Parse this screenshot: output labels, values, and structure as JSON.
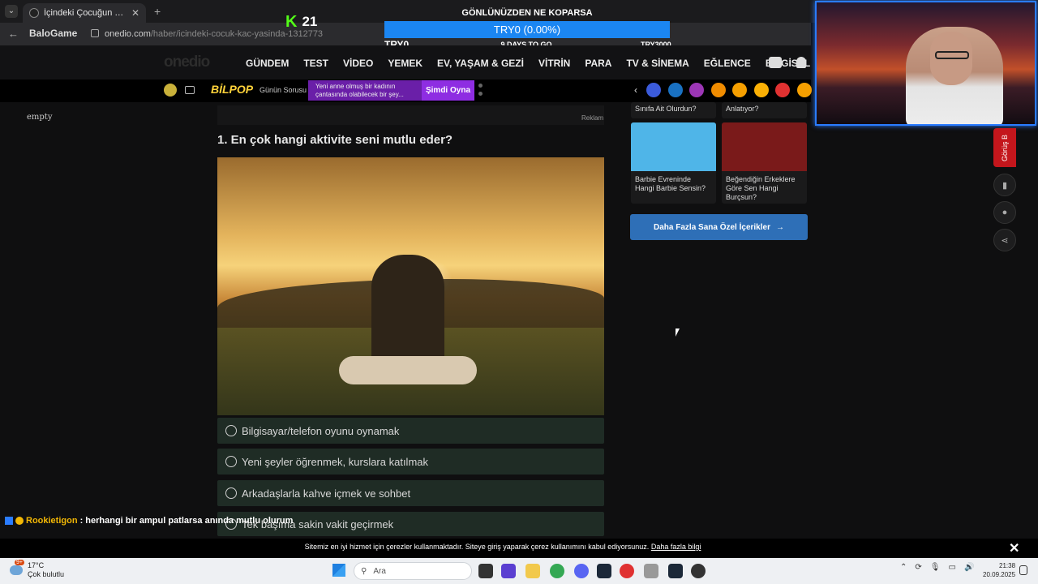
{
  "browser": {
    "tab_title": "İçindeki Çocuğun Yaşı Seni Çok",
    "url_host": "onedio.com",
    "url_path": "/haber/icindeki-cocuk-kac-yasinda-1312773",
    "overlay_stub": "BaloGame"
  },
  "stream": {
    "kick_count": "21",
    "donation_title": "GÖNLÜNÜZDEN NE KOPARSA",
    "donation_progress": "TRY0 (0.00%)",
    "donation_progress_fraction": 0.0,
    "donation_min": "TRY0",
    "donation_days": "9 DAYS TO GO",
    "donation_max": "TRY3000"
  },
  "site": {
    "logo": "onedio",
    "nav": [
      "GÜNDEM",
      "TEST",
      "VİDEO",
      "YEMEK",
      "EV, YAŞAM & GEZİ",
      "VİTRİN",
      "PARA",
      "TV & SİNEMA",
      "EĞLENCE",
      "BİLGİSEL"
    ]
  },
  "subbar": {
    "bilpop": "BİLPOP",
    "daily": "Günün Sorusu",
    "quiz_text": "Yeni anne olmuş bir kadının çantasında olabilecek bir şey...",
    "play": "Şimdi Oyna",
    "story_colors": [
      "#3b5bdb",
      "#1971c2",
      "#9c36b5",
      "#f08c00",
      "#f59f00",
      "#fab005",
      "#e03131",
      "#f59f00"
    ]
  },
  "content": {
    "empty_label": "empty",
    "ad_label": "Reklam",
    "question": "1. En çok hangi aktivite seni mutlu eder?",
    "options": [
      "Bilgisayar/telefon oyunu oynamak",
      "Yeni şeyler öğrenmek, kurslara katılmak",
      "Arkadaşlarla kahve içmek ve sohbet",
      "Tek başıma sakin vakit geçirmek"
    ]
  },
  "sidebar": {
    "top_cards": [
      "Sınıfa Ait Olurdun?",
      "Anlatıyor?"
    ],
    "cards": [
      {
        "title": "Barbie Evreninde Hangi Barbie Sensin?",
        "thumb_color": "#4fb5e8"
      },
      {
        "title": "Beğendiğin Erkeklere Göre Sen Hangi Burçsun?",
        "thumb_color": "#7a1a1a"
      }
    ],
    "more_button": "Daha Fazla Sana Özel İçerikler",
    "side_tab": "Görüş B"
  },
  "chat": {
    "user": "Rookietigon",
    "message": ": herhangi bir ampul patlarsa anında mutlu olurum"
  },
  "cookie": {
    "text": "Sitemiz en iyi hizmet için çerezler kullanmaktadır. Siteye giriş yaparak çerez kullanımını kabul ediyorsunuz.",
    "link": "Daha fazla bilgi"
  },
  "taskbar": {
    "temperature": "17°C",
    "weather": "Çok bulutlu",
    "search": "Ara",
    "time": "21:38",
    "date": "20.09.2025",
    "weather_badge": "9+"
  }
}
